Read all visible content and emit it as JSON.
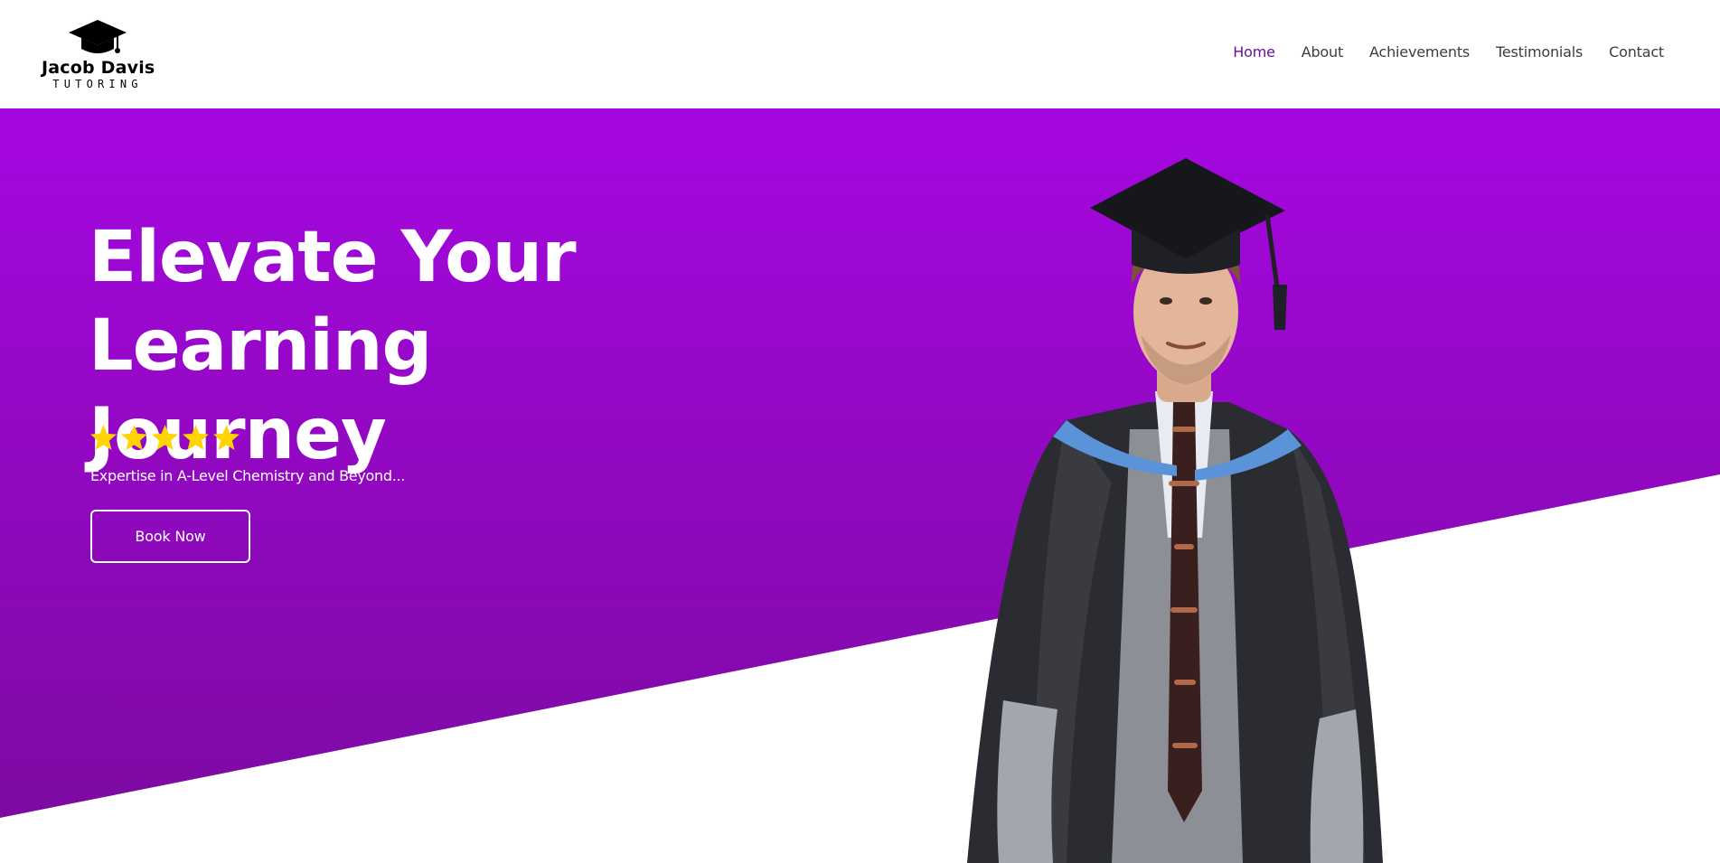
{
  "header": {
    "logo": {
      "name": "Jacob Davis",
      "subtitle": "TUTORING",
      "icon": "graduation-cap-icon"
    },
    "nav": [
      {
        "label": "Home",
        "active": true
      },
      {
        "label": "About",
        "active": false
      },
      {
        "label": "Achievements",
        "active": false
      },
      {
        "label": "Testimonials",
        "active": false
      },
      {
        "label": "Contact",
        "active": false
      }
    ]
  },
  "hero": {
    "headline_line1": "Elevate Your Learning",
    "headline_line2": "Journey",
    "rating": {
      "stars": 5,
      "out_of": 5,
      "icon": "star-icon"
    },
    "tagline": "Expertise in A-Level Chemistry and Beyond...",
    "cta_label": "Book Now",
    "portrait_icon": "graduate-portrait"
  },
  "colors": {
    "brand_purple": "#a507e0",
    "brand_purple_dark": "#7a0b9e",
    "nav_active": "#6a0f9a",
    "star": "#ffd400",
    "white": "#ffffff"
  }
}
